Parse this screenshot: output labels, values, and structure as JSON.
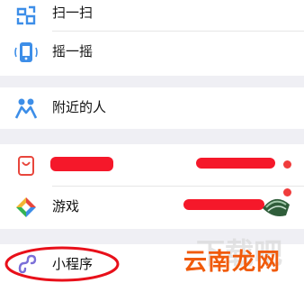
{
  "groups": [
    {
      "items": [
        {
          "label": "扫一扫",
          "icon": "scan-icon"
        },
        {
          "label": "摇一摇",
          "icon": "shake-icon"
        }
      ]
    },
    {
      "items": [
        {
          "label": "附近的人",
          "icon": "people-nearby-icon"
        }
      ]
    },
    {
      "items": [
        {
          "label": "",
          "icon": "shopping-bag-icon",
          "badge": true
        },
        {
          "label": "游戏",
          "icon": "game-icon",
          "badge": true
        }
      ]
    },
    {
      "items": [
        {
          "label": "小程序",
          "icon": "mini-program-icon"
        }
      ]
    }
  ],
  "watermark": {
    "text": "云南龙网"
  },
  "colors": {
    "accent": "#3d8ee8",
    "badge": "#f03c3c",
    "background": "#efeff4"
  }
}
